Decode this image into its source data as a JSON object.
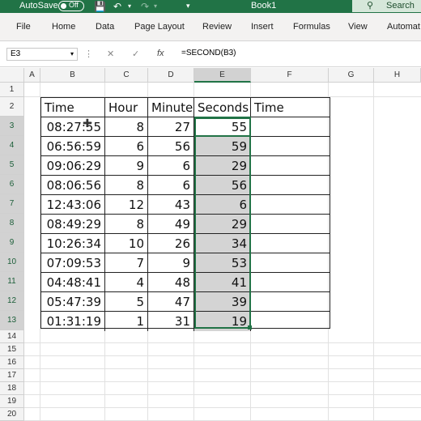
{
  "titlebar": {
    "autosave_label": "AutoSave",
    "autosave_state": "Off",
    "title": "Book1",
    "search_label": "Search"
  },
  "ribbon": {
    "tabs": [
      "File",
      "Home",
      "Data",
      "Page Layout",
      "Review",
      "Insert",
      "Formulas",
      "View",
      "Automat"
    ]
  },
  "formula_bar": {
    "name_box": "E3",
    "fx_label": "fx",
    "formula": "=SECOND(B3)"
  },
  "sheet": {
    "columns": [
      "A",
      "B",
      "C",
      "D",
      "E",
      "F",
      "G",
      "H"
    ],
    "selected_column": "E",
    "rows": [
      "1",
      "2",
      "3",
      "4",
      "5",
      "6",
      "7",
      "8",
      "9",
      "10",
      "11",
      "12",
      "13",
      "14",
      "15",
      "16",
      "17",
      "18",
      "19",
      "20"
    ],
    "headers": [
      "Time",
      "Hour",
      "Minute",
      "Seconds",
      "Time"
    ],
    "data": [
      [
        "08:27:55",
        "8",
        "27",
        "55"
      ],
      [
        "06:56:59",
        "6",
        "56",
        "59"
      ],
      [
        "09:06:29",
        "9",
        "6",
        "29"
      ],
      [
        "08:06:56",
        "8",
        "6",
        "56"
      ],
      [
        "12:43:06",
        "12",
        "43",
        "6"
      ],
      [
        "08:49:29",
        "8",
        "49",
        "29"
      ],
      [
        "10:26:34",
        "10",
        "26",
        "34"
      ],
      [
        "07:09:53",
        "7",
        "9",
        "53"
      ],
      [
        "04:48:41",
        "4",
        "48",
        "41"
      ],
      [
        "05:47:39",
        "5",
        "47",
        "39"
      ],
      [
        "01:31:19",
        "1",
        "31",
        "19"
      ]
    ]
  },
  "colors": {
    "accent": "#217346",
    "selection_fill": "#d4d4d4"
  }
}
